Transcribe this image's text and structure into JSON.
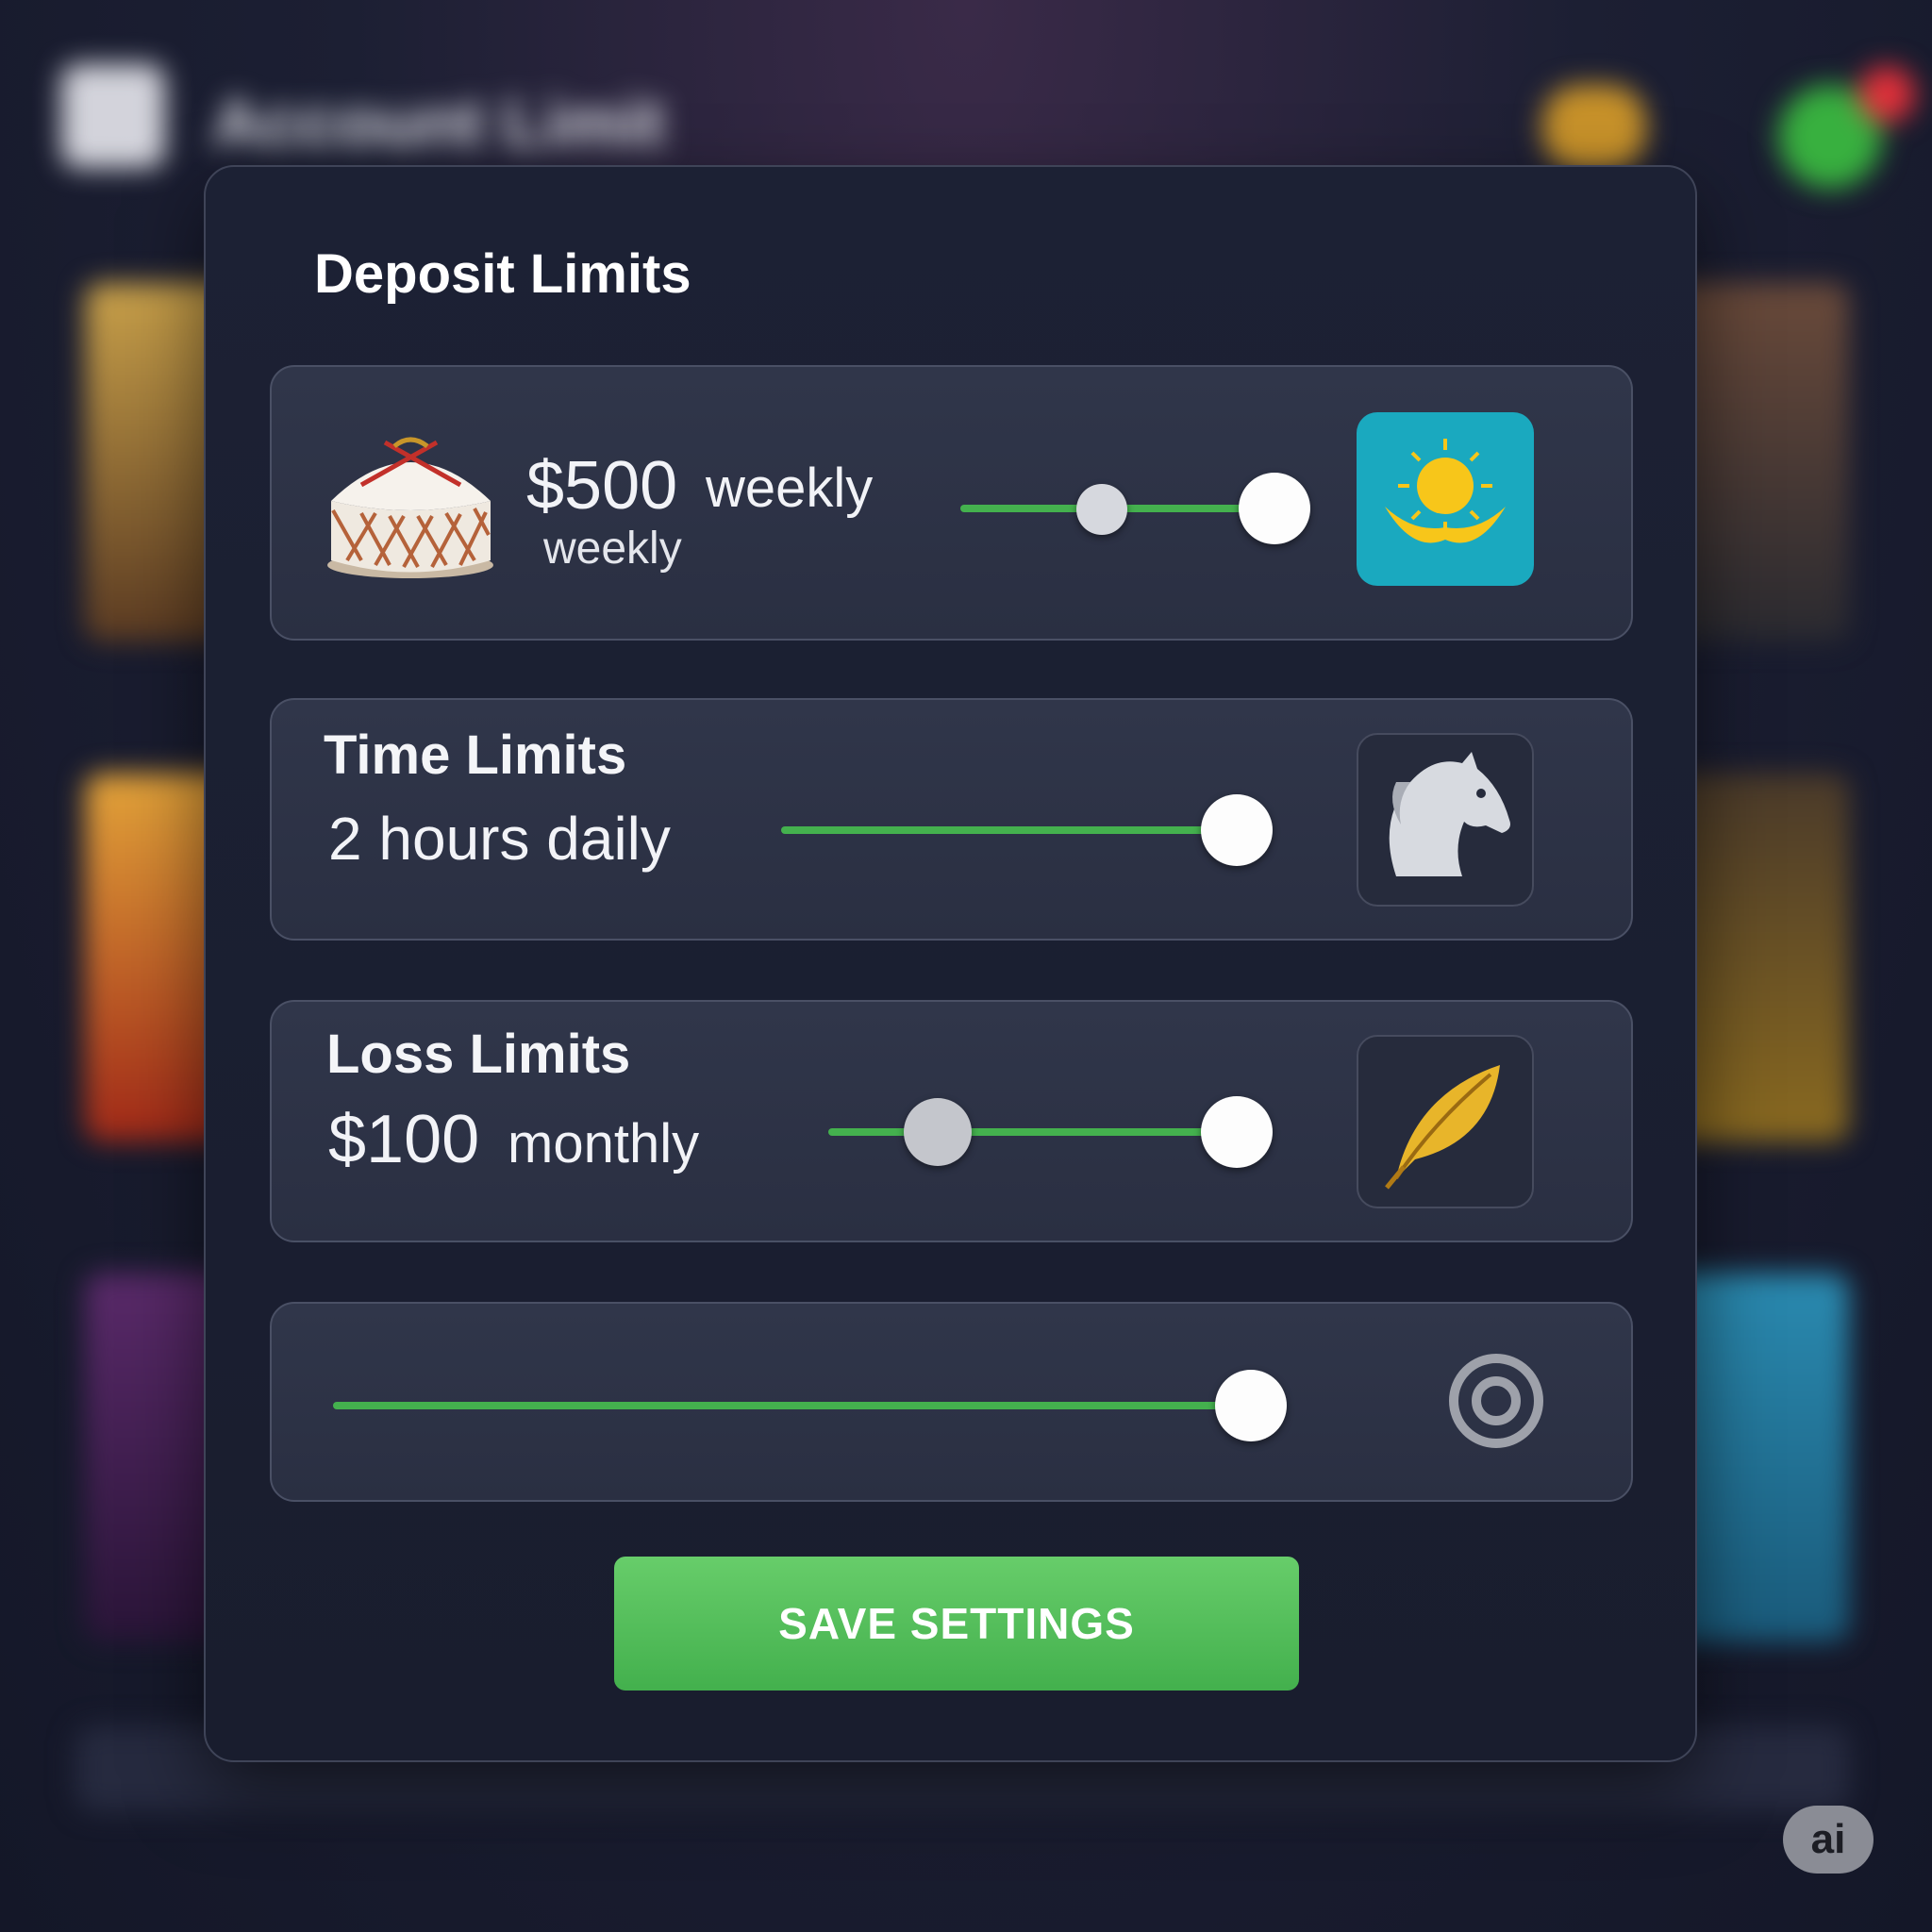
{
  "background": {
    "header_title": "Account Limit"
  },
  "modal": {
    "title": "Deposit Limits",
    "deposit": {
      "amount": "$500",
      "period_inline": "weekly",
      "period_sub": "weekly",
      "slider_low": 0.3,
      "slider_high": 0.9,
      "icon": "yurt-icon",
      "badge_icon": "kazakhstan-flag-icon"
    },
    "time": {
      "title": "Time Limits",
      "value": "2 hours daily",
      "slider_value": 0.93,
      "badge_icon": "horse-head-icon"
    },
    "loss": {
      "title": "Loss Limits",
      "amount": "$100",
      "period": "monthly",
      "slider_low": 0.25,
      "slider_high": 0.92,
      "badge_icon": "feather-icon"
    },
    "extra": {
      "slider_value": 0.96,
      "badge_icon": "target-icon"
    },
    "save_label": "SAVE SETTINGS"
  },
  "badge": {
    "label": "ai"
  },
  "colors": {
    "accent": "#44b14e",
    "flag": "#1aa9bf",
    "panel": "#2d3246"
  }
}
